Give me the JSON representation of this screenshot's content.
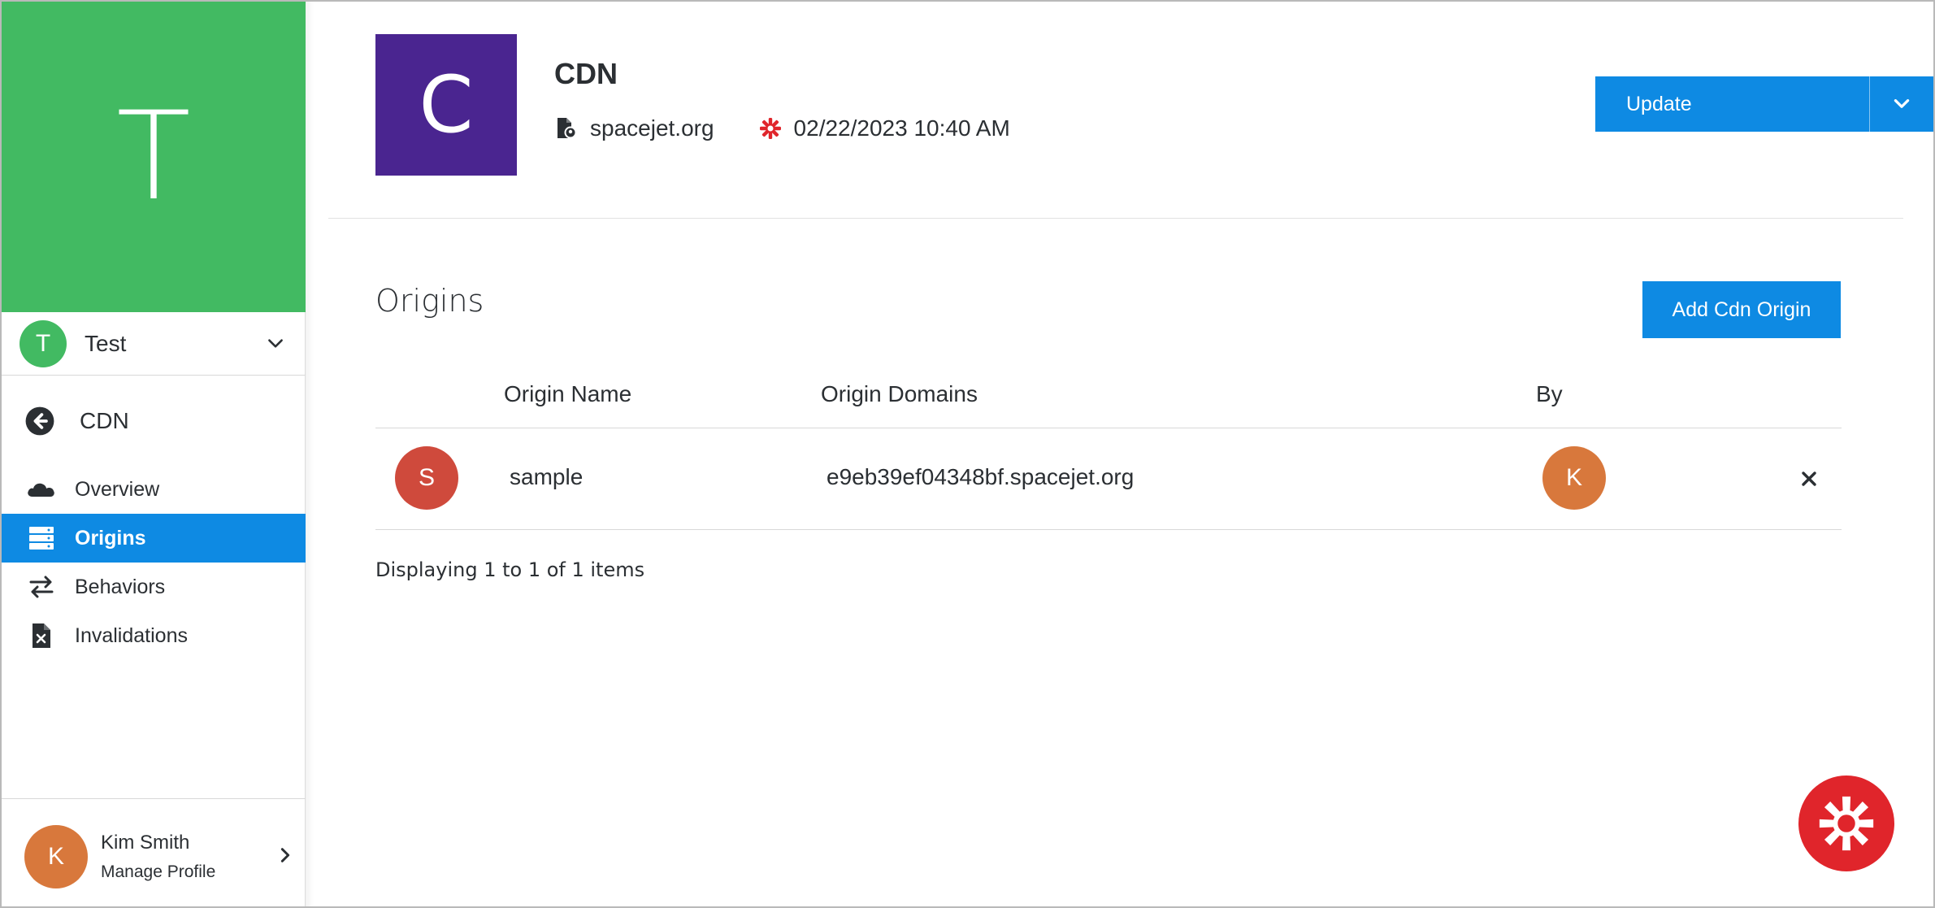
{
  "sidebar": {
    "org_tile_letter": "T",
    "org_select": {
      "avatar_letter": "T",
      "label": "Test",
      "icon": "chevron-down-icon"
    },
    "back": {
      "label": "CDN",
      "icon": "arrow-left-circle-icon"
    },
    "nav_items": [
      {
        "label": "Overview",
        "icon": "cloud-icon",
        "active": false
      },
      {
        "label": "Origins",
        "icon": "server-stack-icon",
        "active": true
      },
      {
        "label": "Behaviors",
        "icon": "swap-arrows-icon",
        "active": false
      },
      {
        "label": "Invalidations",
        "icon": "file-x-icon",
        "active": false
      }
    ],
    "profile": {
      "avatar_letter": "K",
      "name": "Kim Smith",
      "sub": "Manage Profile"
    }
  },
  "header": {
    "app_letter": "C",
    "title": "CDN",
    "domain": "spacejet.org",
    "date": "02/22/2023 10:40 AM",
    "update_label": "Update",
    "colors": {
      "org_tile": "#42ba62",
      "app_tile": "#4a2590",
      "primary": "#0e8ae3",
      "brand_red": "#e0252b"
    }
  },
  "origins": {
    "title": "Origins",
    "add_label": "Add Cdn Origin",
    "columns": [
      "Origin Name",
      "Origin Domains",
      "By"
    ],
    "rows": [
      {
        "avatar_letter": "S",
        "name": "sample",
        "domain": "e9eb39ef04348bf.spacejet.org",
        "by_letter": "K"
      }
    ],
    "pager": "Displaying 1 to 1 of 1 items"
  }
}
